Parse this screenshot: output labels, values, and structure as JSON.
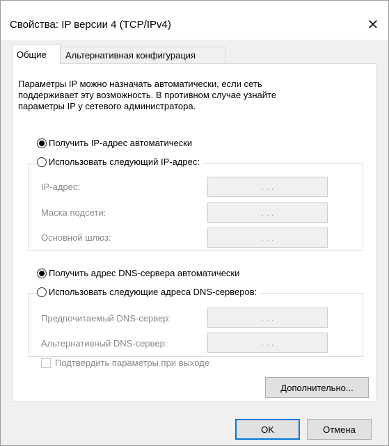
{
  "window": {
    "title": "Свойства: IP версии 4 (TCP/IPv4)",
    "close_glyph": "✕"
  },
  "tabs": [
    {
      "label": "Общие",
      "active": true
    },
    {
      "label": "Альтернативная конфигурация",
      "active": false
    }
  ],
  "description": {
    "line1": "Параметры IP можно назначать автоматически, если сеть",
    "line2": "поддерживает эту возможность. В противном случае узнайте",
    "line3": "параметры IP у сетевого администратора."
  },
  "ip": {
    "auto_label": "Получить IP-адрес автоматически",
    "auto_selected": true,
    "manual_label": "Использовать следующий IP-адрес:",
    "manual_selected": false,
    "fields": [
      {
        "label": "IP-адрес:",
        "value": ".   .   ."
      },
      {
        "label": "Маска подсети:",
        "value": ".   .   ."
      },
      {
        "label": "Основной шлюз:",
        "value": ".   .   ."
      }
    ]
  },
  "dns": {
    "auto_label": "Получить адрес DNS-сервера автоматически",
    "auto_selected": true,
    "manual_label": "Использовать следующие адреса DNS-серверов:",
    "manual_selected": false,
    "fields": [
      {
        "label": "Предпочитаемый DNS-сервер:",
        "value": ".   .   ."
      },
      {
        "label": "Альтернативный DNS-сервер:",
        "value": ".   .   ."
      }
    ]
  },
  "validate_checkbox": {
    "label": "Подтвердить параметры при выходе",
    "checked": false,
    "enabled": false
  },
  "buttons": {
    "advanced": "Дополнительно...",
    "ok": "OK",
    "cancel": "Отмена"
  },
  "colors": {
    "accent": "#0078d7",
    "disabled_text": "#8a8a8a"
  }
}
